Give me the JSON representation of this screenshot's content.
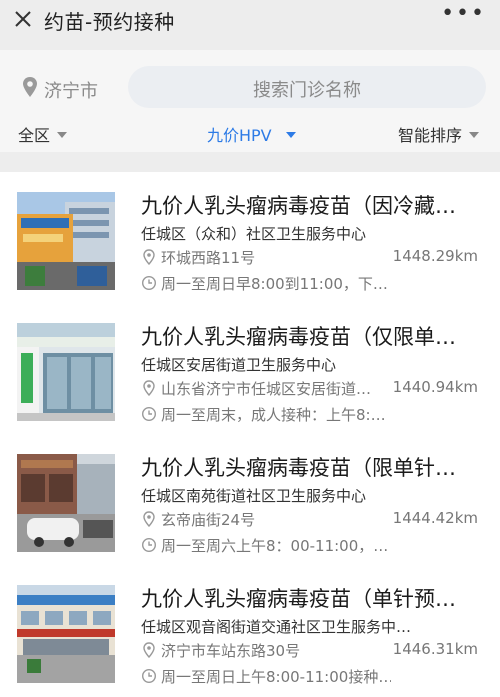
{
  "topbar": {
    "close_icon": "close-icon",
    "title": "约苗-预约接种",
    "more_label": "•••"
  },
  "search": {
    "city": "济宁市",
    "placeholder": "搜索门诊名称"
  },
  "filters": {
    "region": "全区",
    "vaccine": "九价HPV",
    "sort": "智能排序",
    "active_color": "#2d7be6"
  },
  "clinics": [
    {
      "title": "九价人乳头瘤病毒疫苗（因冷藏…",
      "center": "任城区（众和）社区卫生服务中心",
      "address": "环城西路11号",
      "distance": "1448.29km",
      "hours": "周一至周日早8:00到11:00，下…"
    },
    {
      "title": "九价人乳头瘤病毒疫苗（仅限单…",
      "center": "任城区安居街道卫生服务中心",
      "address": "山东省济宁市任城区安居街道…",
      "distance": "1440.94km",
      "hours": "周一至周末，成人接种：上午8:…"
    },
    {
      "title": "九价人乳头瘤病毒疫苗（限单针…",
      "center": "任城区南苑街道社区卫生服务中心",
      "address": "玄帝庙街24号",
      "distance": "1444.42km",
      "hours": "周一至周六上午8：00-11:00，…"
    },
    {
      "title": "九价人乳头瘤病毒疫苗（单针预…",
      "center": "任城区观音阁街道交通社区卫生服务中…",
      "address": "济宁市车站东路30号",
      "distance": "1446.31km",
      "hours": "周一至周日上午8:00-11:00接种…"
    }
  ]
}
